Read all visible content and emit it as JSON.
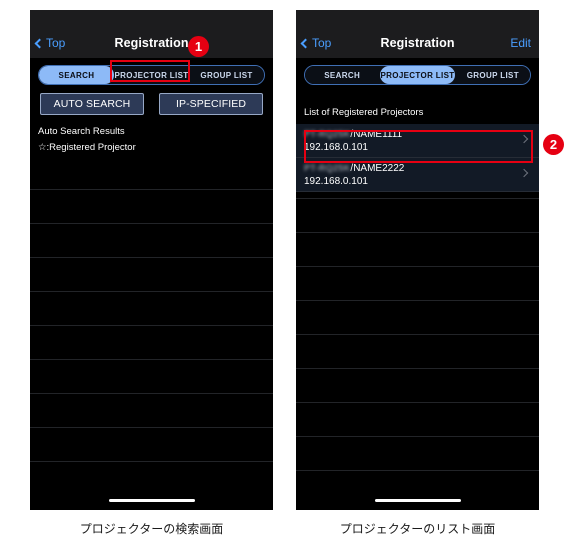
{
  "figure": {
    "captions": {
      "left": "プロジェクターの検索画面",
      "right": "プロジェクターのリスト画面"
    },
    "badges": {
      "one": "1",
      "two": "2"
    },
    "accent_red": "#e60012",
    "accent_blue": "#4a9eff",
    "segment_active_bg": "#8dbaf7"
  },
  "left_screen": {
    "nav": {
      "back_label": "Top",
      "title": "Registration"
    },
    "segments": [
      {
        "label": "SEARCH",
        "active": true
      },
      {
        "label": "PROJECTOR LIST",
        "active": false
      },
      {
        "label": "GROUP LIST",
        "active": false
      }
    ],
    "buttons": {
      "auto_search": "AUTO SEARCH",
      "ip_specified": "IP-SPECIFIED"
    },
    "results_label": "Auto Search Results",
    "legend_label": "☆:Registered Projector",
    "empty_rows": 9
  },
  "right_screen": {
    "nav": {
      "back_label": "Top",
      "title": "Registration",
      "edit_label": "Edit"
    },
    "segments": [
      {
        "label": "SEARCH",
        "active": false
      },
      {
        "label": "PROJECTOR LIST",
        "active": true
      },
      {
        "label": "GROUP LIST",
        "active": false
      }
    ],
    "list_caption": "List of Registered Projectors",
    "projectors": [
      {
        "model": "PT-RQ25K",
        "name": "/NAME1111",
        "ip": "192.168.0.101",
        "highlighted": true
      },
      {
        "model": "PT-RQ25K",
        "name": "/NAME2222",
        "ip": "192.168.0.101",
        "highlighted": false
      }
    ],
    "empty_rows": 9
  }
}
